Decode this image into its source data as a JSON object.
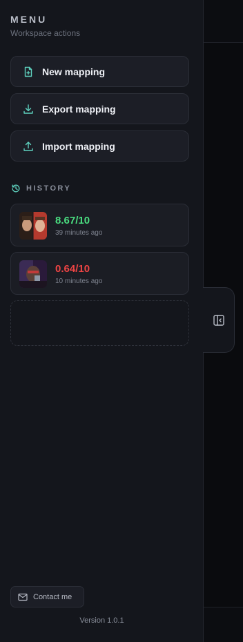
{
  "menu": {
    "title": "MENU",
    "subtitle": "Workspace actions"
  },
  "actions": [
    {
      "label": "New mapping",
      "icon": "file-plus-icon"
    },
    {
      "label": "Export mapping",
      "icon": "download-icon"
    },
    {
      "label": "Import mapping",
      "icon": "upload-icon"
    }
  ],
  "history": {
    "title": "HISTORY",
    "icon": "history-icon",
    "items": [
      {
        "score": "8.67/10",
        "time": "39 minutes ago",
        "score_color": "#4ade80"
      },
      {
        "score": "0.64/10",
        "time": "10 minutes ago",
        "score_color": "#ef4444"
      }
    ]
  },
  "footer": {
    "contact_label": "Contact me",
    "version": "Version 1.0.1"
  },
  "colors": {
    "accent_icon": "#5fd3c0",
    "good": "#4ade80",
    "bad": "#ef4444"
  }
}
